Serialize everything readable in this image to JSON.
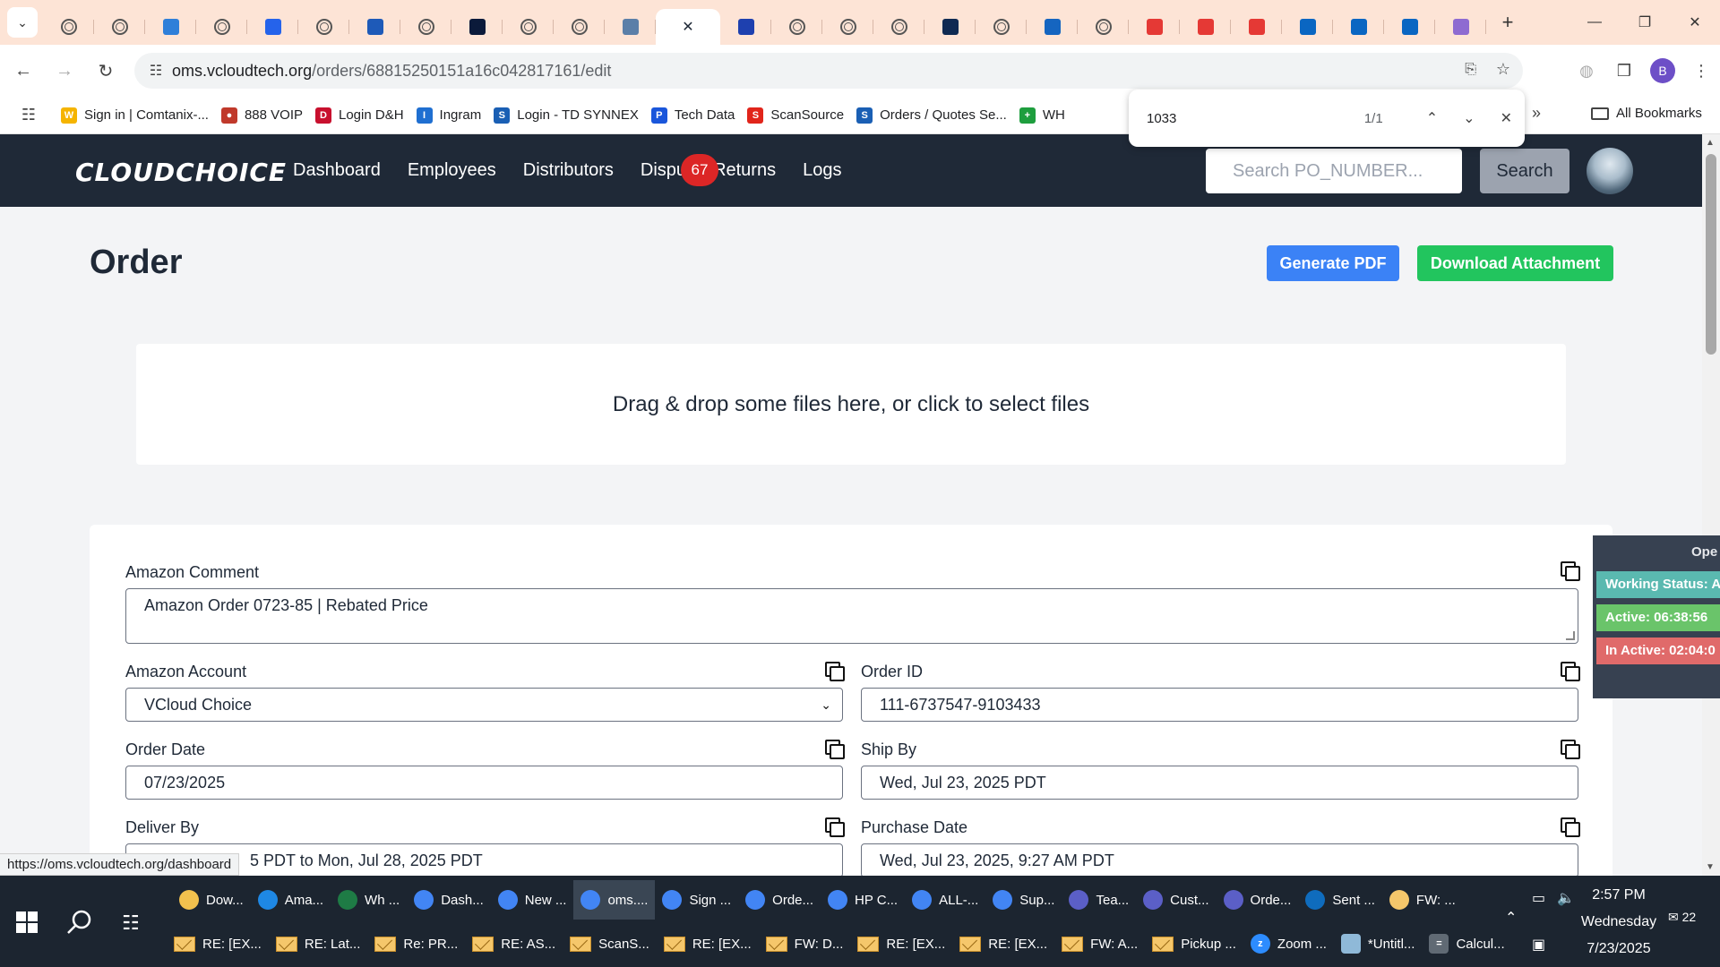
{
  "browser": {
    "active_tab_close": "✕",
    "url_host": "oms.vcloudtech.org",
    "url_path": "/orders/68815250151a16c042817161/edit",
    "profile_initial": "B",
    "bookmarks": [
      {
        "label": "Sign in | Comtanix-...",
        "icon": "W",
        "color": "#f5b400"
      },
      {
        "label": "888 VOIP",
        "icon": "●",
        "color": "#c0392b"
      },
      {
        "label": "Login D&H",
        "icon": "D",
        "color": "#c8102e"
      },
      {
        "label": "Ingram",
        "icon": "I",
        "color": "#1f6fd1"
      },
      {
        "label": "Login - TD SYNNEX",
        "icon": "S",
        "color": "#1a5fb4"
      },
      {
        "label": "Tech Data",
        "icon": "P",
        "color": "#1a56db"
      },
      {
        "label": "ScanSource",
        "icon": "S",
        "color": "#e1251b"
      },
      {
        "label": "Orders / Quotes Se...",
        "icon": "S",
        "color": "#1a5fb4"
      },
      {
        "label": "WH",
        "icon": "+",
        "color": "#1e9e3e"
      }
    ],
    "all_bookmarks": "All Bookmarks",
    "status_url": "https://oms.vcloudtech.org/dashboard"
  },
  "find_bar": {
    "query": "1033",
    "count": "1/1"
  },
  "app": {
    "logo": "CLOUDCHOICE",
    "nav": [
      "Dashboard",
      "Employees",
      "Distributors",
      "Dispu",
      "Returns",
      "Logs"
    ],
    "disputes_badge": "67",
    "search_placeholder": "Search PO_NUMBER...",
    "search_button": "Search"
  },
  "page": {
    "title": "Order",
    "generate_pdf": "Generate PDF",
    "download_attachment": "Download Attachment",
    "dropzone_text": "Drag & drop some files here, or click to select files"
  },
  "form": {
    "amazon_comment_label": "Amazon Comment",
    "amazon_comment_value": "Amazon Order 0723-85 | Rebated Price",
    "amazon_account_label": "Amazon Account",
    "amazon_account_value": "VCloud Choice",
    "order_id_label": "Order ID",
    "order_id_value": "111-6737547-9103433",
    "order_date_label": "Order Date",
    "order_date_value": "07/23/2025",
    "ship_by_label": "Ship By",
    "ship_by_value": "Wed, Jul 23, 2025 PDT",
    "deliver_by_label": "Deliver By",
    "deliver_by_value": "5 PDT to Mon, Jul 28, 2025 PDT",
    "purchase_date_label": "Purchase Date",
    "purchase_date_value": "Wed, Jul 23, 2025, 9:27 AM PDT"
  },
  "status_widget": {
    "header": "Ope",
    "working": "Working Status: A",
    "active": "Active: 06:38:56",
    "inactive": "In Active: 02:04:0"
  },
  "taskbar": {
    "row1": [
      {
        "label": "Dow...",
        "color": "#f2c14e"
      },
      {
        "label": "Ama...",
        "color": "#1e88e5"
      },
      {
        "label": "Wh ...",
        "color": "#1e7b45"
      },
      {
        "label": "Dash...",
        "color": "#4285f4"
      },
      {
        "label": "New ...",
        "color": "#4285f4"
      },
      {
        "label": "oms....",
        "color": "#4285f4"
      },
      {
        "label": "Sign ...",
        "color": "#4285f4"
      },
      {
        "label": "Orde...",
        "color": "#4285f4"
      },
      {
        "label": "HP C...",
        "color": "#4285f4"
      },
      {
        "label": "ALL-...",
        "color": "#4285f4"
      },
      {
        "label": "Sup...",
        "color": "#4285f4"
      },
      {
        "label": "Tea...",
        "color": "#5b5fc7"
      },
      {
        "label": "Cust...",
        "color": "#5b5fc7"
      },
      {
        "label": "Orde...",
        "color": "#5b5fc7"
      },
      {
        "label": "Sent ...",
        "color": "#0f6cbd"
      },
      {
        "label": "FW: ...",
        "color": "#f5c76b"
      }
    ],
    "row2": [
      {
        "label": "RE: [EX...",
        "type": "mail"
      },
      {
        "label": "RE: Lat...",
        "type": "mail"
      },
      {
        "label": "Re: PR...",
        "type": "mail"
      },
      {
        "label": "RE: AS...",
        "type": "mail"
      },
      {
        "label": "ScanS...",
        "type": "mail"
      },
      {
        "label": "RE: [EX...",
        "type": "mail"
      },
      {
        "label": "FW: D...",
        "type": "mail"
      },
      {
        "label": "RE: [EX...",
        "type": "mail"
      },
      {
        "label": "RE: [EX...",
        "type": "mail"
      },
      {
        "label": "FW: A...",
        "type": "mail"
      },
      {
        "label": "Pickup ...",
        "type": "mail"
      },
      {
        "label": "Zoom ...",
        "type": "zoom"
      },
      {
        "label": "*Untitl...",
        "type": "notepad"
      },
      {
        "label": "Calcul...",
        "type": "calc"
      }
    ],
    "time": "2:57 PM",
    "day": "Wednesday",
    "date": "7/23/2025",
    "notifications": "22"
  }
}
